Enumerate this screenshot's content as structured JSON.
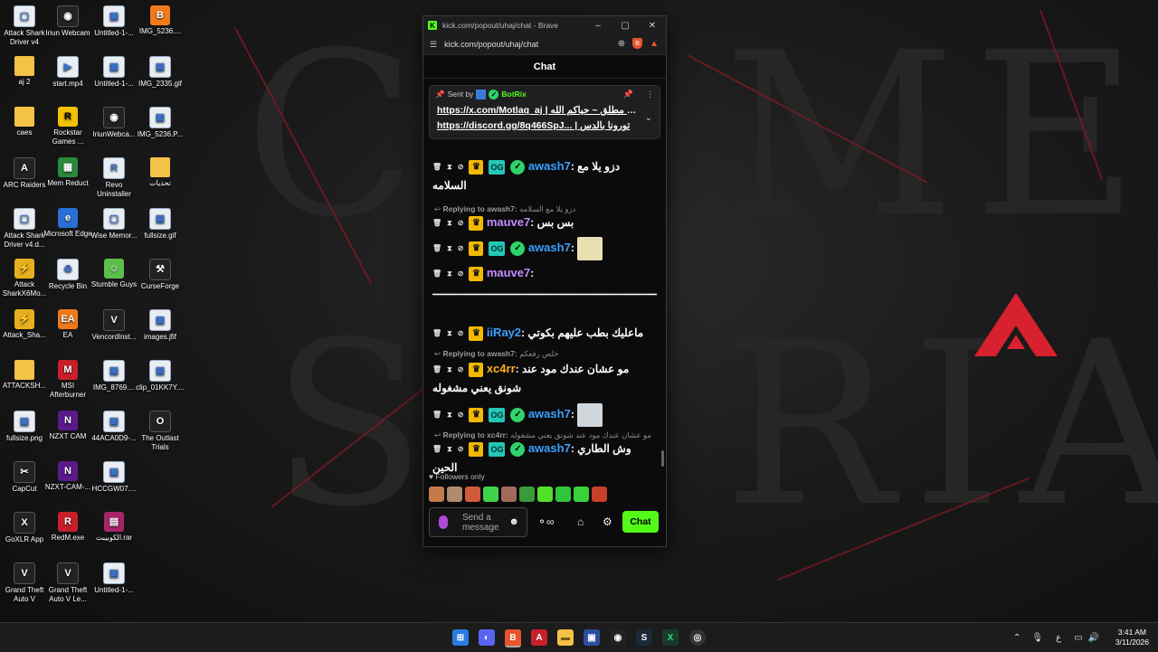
{
  "desktop": {
    "icons": [
      {
        "label": "Attack Shark Driver v4",
        "icon": "file-icon"
      },
      {
        "label": "Iriun Webcam",
        "icon": "webcam-icon"
      },
      {
        "label": "Untitled-1-...",
        "icon": "image-file-icon"
      },
      {
        "label": "IMG_5236....",
        "icon": "brave-icon"
      },
      {
        "label": "aj 2",
        "icon": "folder-icon"
      },
      {
        "label": "start.mp4",
        "icon": "video-file-icon"
      },
      {
        "label": "Untitled-1-...",
        "icon": "image-file-icon"
      },
      {
        "label": "IMG_2335.gif",
        "icon": "image-file-icon"
      },
      {
        "label": "caes",
        "icon": "folder-icon"
      },
      {
        "label": "Rockstar Games ...",
        "icon": "rockstar-icon"
      },
      {
        "label": "IriunWebca...",
        "icon": "webcam-icon"
      },
      {
        "label": "IMG_5236.P...",
        "icon": "image-file-icon"
      },
      {
        "label": "ARC Raiders",
        "icon": "game-icon"
      },
      {
        "label": "Mem Reduct",
        "icon": "memory-icon"
      },
      {
        "label": "Revo Uninstaller",
        "icon": "uninstaller-icon"
      },
      {
        "label": "تحديات",
        "icon": "folder-icon"
      },
      {
        "label": "Attack Shark Driver v4.d...",
        "icon": "file-icon"
      },
      {
        "label": "Microsoft Edge",
        "icon": "edge-icon"
      },
      {
        "label": "Wise Memor...",
        "icon": "file-icon"
      },
      {
        "label": "fullsize.gif",
        "icon": "image-file-icon"
      },
      {
        "label": "Attack SharkX6Mo...",
        "icon": "mouse-icon"
      },
      {
        "label": "Recycle Bin",
        "icon": "recycle-bin-icon"
      },
      {
        "label": "Stumble Guys",
        "icon": "game-icon"
      },
      {
        "label": "CurseForge",
        "icon": "anvil-icon"
      },
      {
        "label": "Attack_Sha...",
        "icon": "mouse-icon"
      },
      {
        "label": "EA",
        "icon": "ea-icon"
      },
      {
        "label": "VencordInst...",
        "icon": "vencord-icon"
      },
      {
        "label": "images.jfif",
        "icon": "image-file-icon"
      },
      {
        "label": "ATTACKSH...",
        "icon": "folder-icon"
      },
      {
        "label": "MSI Afterburner",
        "icon": "afterburner-icon"
      },
      {
        "label": "IMG_8769....",
        "icon": "image-file-icon"
      },
      {
        "label": "clip_01KK7Y....",
        "icon": "image-file-icon"
      },
      {
        "label": "fullsize.png",
        "icon": "image-file-icon"
      },
      {
        "label": "NZXT CAM",
        "icon": "nzxt-icon"
      },
      {
        "label": "44ACA0D9-...",
        "icon": "image-file-icon"
      },
      {
        "label": "The Outlast Trials",
        "icon": "game-icon"
      },
      {
        "label": "CapCut",
        "icon": "capcut-icon"
      },
      {
        "label": "NZXT-CAM-...",
        "icon": "nzxt-icon"
      },
      {
        "label": "HCCGW07....",
        "icon": "image-file-icon"
      },
      {
        "label": "GoXLR App",
        "icon": "goxlr-icon"
      },
      {
        "label": "RedM.exe",
        "icon": "redm-icon"
      },
      {
        "label": "الكوبيبت.rar",
        "icon": "archive-icon"
      },
      {
        "label": "Grand Theft Auto V",
        "icon": "gta-icon"
      },
      {
        "label": "Grand Theft Auto V Le...",
        "icon": "gta-icon"
      },
      {
        "label": "Untitled-1-...",
        "icon": "image-file-icon"
      }
    ]
  },
  "window": {
    "title": "kick.com/popout/uhaj/chat - Brave",
    "url": "kick.com/popout/uhaj/chat",
    "header": "Chat"
  },
  "pinned": {
    "sent_by": "Sent by",
    "username": "BotRix",
    "line1": "https://x.com/Motlaq_aj | تويتر مطلق ~ حياكم الله",
    "line2": "https://discord.gg/8q466SpJ... | تورونا بالدس"
  },
  "messages": [
    {
      "user": "awash7",
      "text": "دزو يلا مع السلامه"
    },
    {
      "reply_label": "Replying to awash7:",
      "reply_text": "دزو يلا مع السلامه"
    },
    {
      "user": "mauve7",
      "text": "بس بس"
    },
    {
      "user": "awash7",
      "text": ""
    },
    {
      "user": "mauve7",
      "text": "ـــــــــــــــــــــــــــــــــــــــــــــــــــــــــــــــــــــــــــــــــ"
    },
    {
      "user": "iiRay2",
      "text": "ماعليك بطب عليهم بكوتي"
    },
    {
      "reply_label": "Replying to awash7:",
      "reply_text": "خلص رفعكم"
    },
    {
      "user": "xc4rr",
      "text": "مو عشان عندك مود عند شونق يعني مشغوله"
    },
    {
      "user": "awash7",
      "text": ""
    },
    {
      "reply_label": "Replying to xc4rr:",
      "reply_text": "مو عشان عندك مود عند شونق يعني مشغوله"
    },
    {
      "user": "awash7",
      "text": "وش الطاري الحين"
    }
  ],
  "footer": {
    "followers_only": "Followers only",
    "send_placeholder": "Send a message",
    "chat_button": "Chat"
  },
  "taskbar": {
    "time": "3:41 AM",
    "date": "3/11/2026",
    "lang": "ع"
  },
  "colors": {
    "kick_green": "#53fc18",
    "accent_red": "#c8202a"
  }
}
